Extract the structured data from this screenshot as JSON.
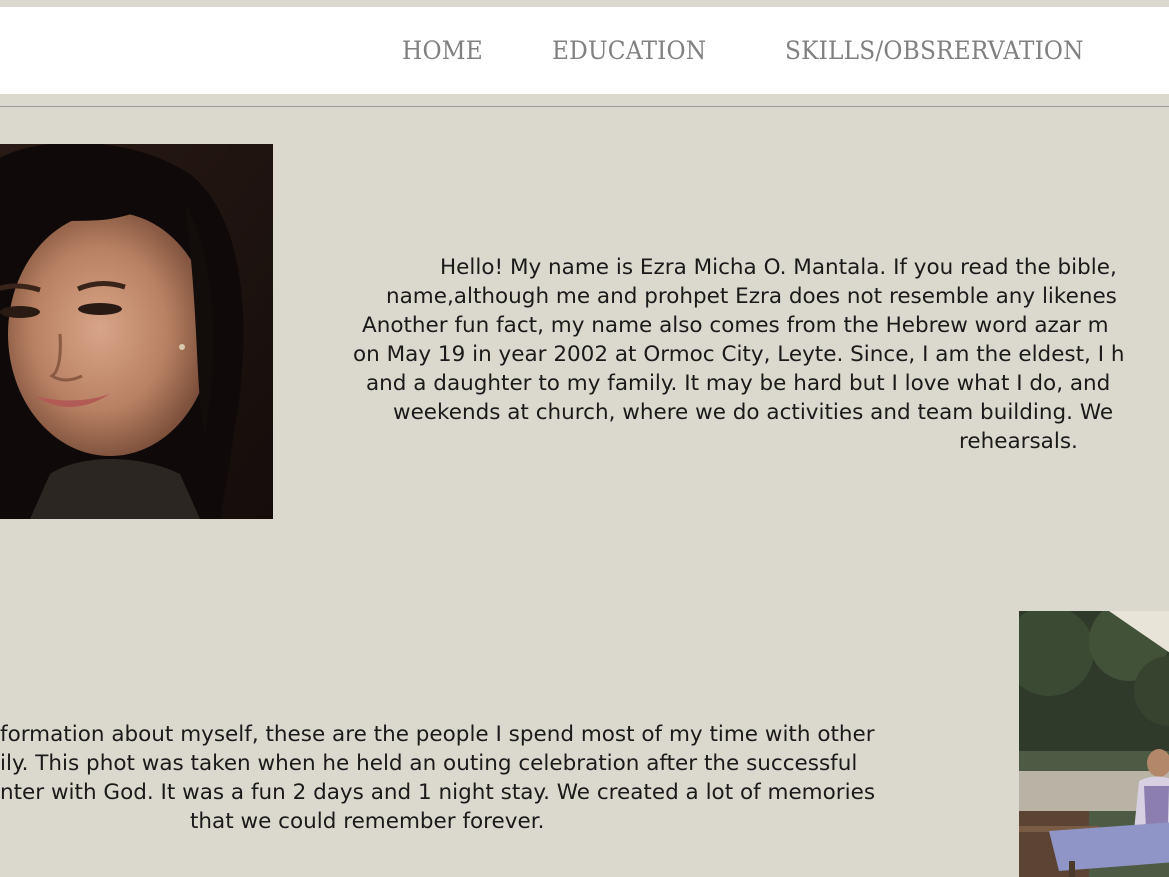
{
  "nav": {
    "home": "HOME",
    "education": "EDUCATION",
    "skills": "SKILLS/OBSRERVATION"
  },
  "about": {
    "lines": [
      "Hello! My name is Ezra Micha O. Mantala. If you read the bible,",
      "name,although me and prohpet Ezra does not resemble any likenes",
      "Another fun fact, my name also comes from the Hebrew word azar m",
      "on May 19 in year 2002 at Ormoc City, Leyte. Since, I am the eldest, I h",
      "and a daughter to my family. It may be hard but I love what I do, and",
      "weekends at church, where we do activities and team building. We",
      "rehearsals."
    ]
  },
  "family": {
    "lines": [
      "formation about myself, these are the people I spend most of my time with other",
      "ily. This phot was taken when he held an outing celebration after the successful",
      "nter with God. It was a fun 2 days and 1 night stay. We created a lot of memories",
      "that we could remember forever."
    ]
  },
  "colors": {
    "background": "#dbd8ce",
    "header": "#ffffff",
    "nav_text": "#808080",
    "body_text": "#1a1a1a"
  }
}
